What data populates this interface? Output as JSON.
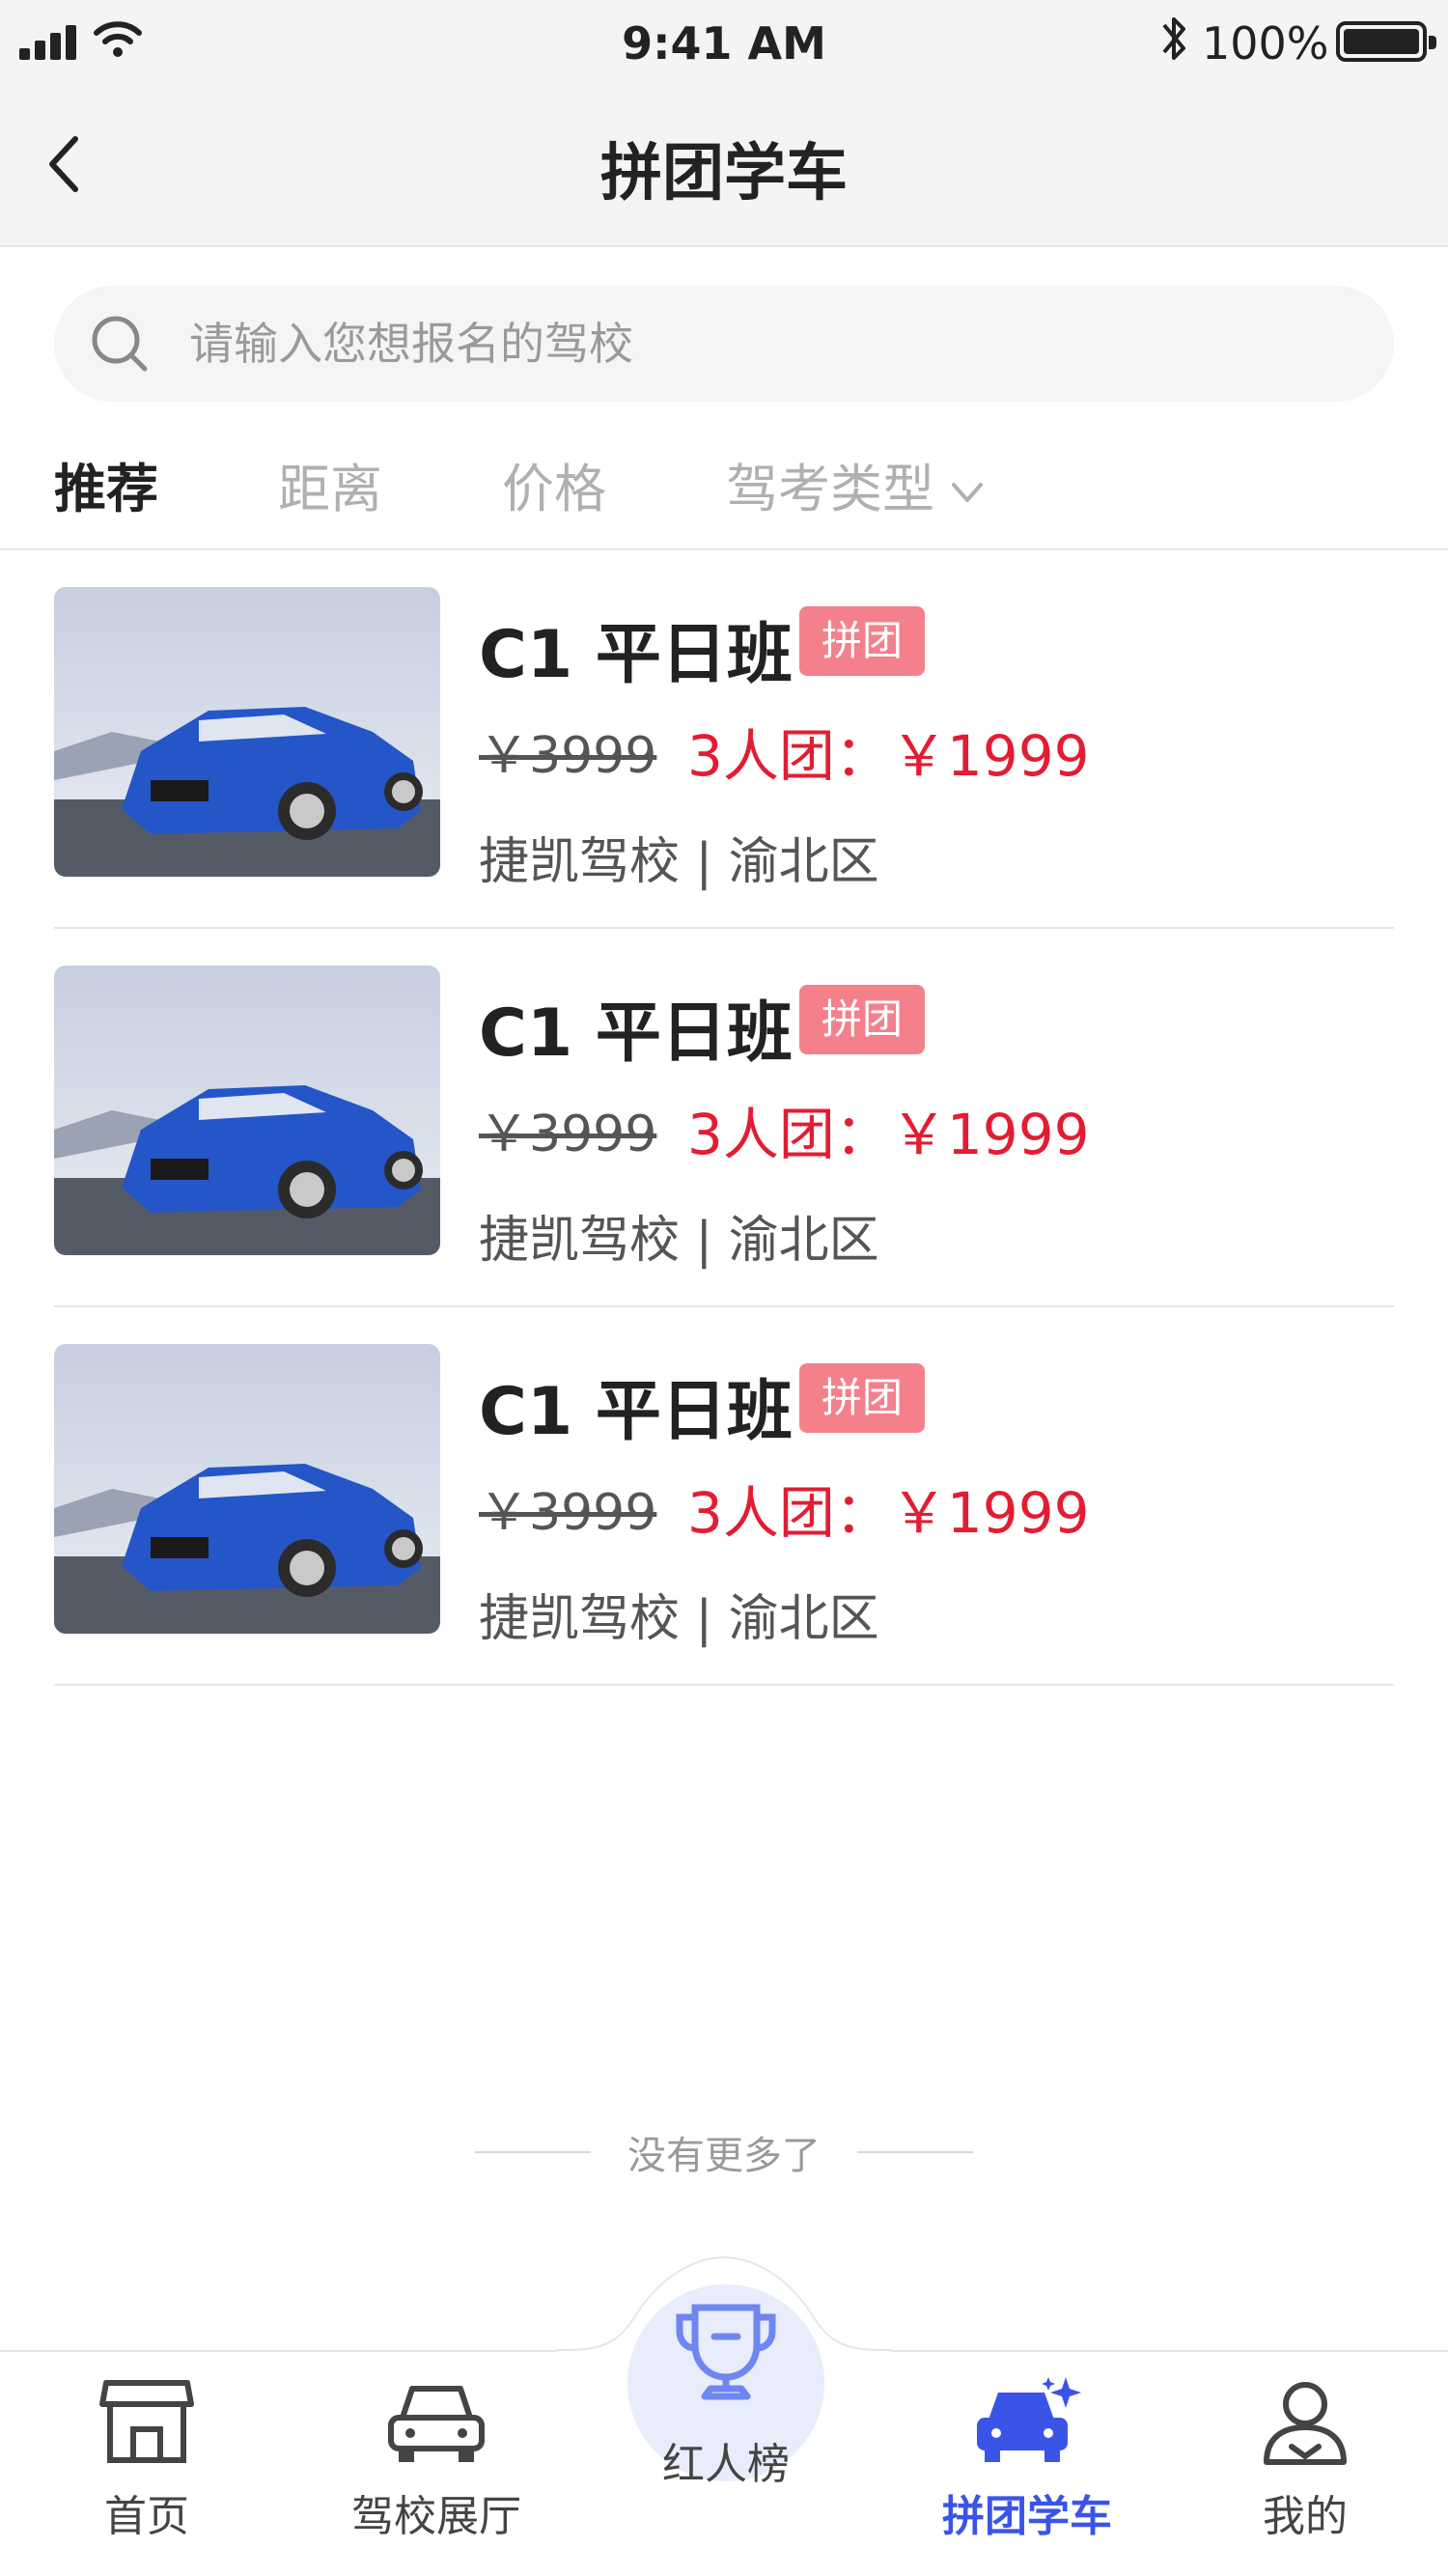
{
  "status_bar": {
    "time": "9:41 AM",
    "battery": "100%"
  },
  "header": {
    "title": "拼团学车"
  },
  "search": {
    "placeholder": "请输入您想报名的驾校"
  },
  "filters": [
    {
      "label": "推荐",
      "active": true
    },
    {
      "label": "距离",
      "active": false
    },
    {
      "label": "价格",
      "active": false
    },
    {
      "label": "驾考类型",
      "active": false,
      "dropdown": true
    }
  ],
  "listings": [
    {
      "name": "C1 平日班",
      "tag": "拼团",
      "original_price": "￥3999",
      "group_price": "3人团：￥1999",
      "school": "捷凯驾校 | 渝北区"
    },
    {
      "name": "C1 平日班",
      "tag": "拼团",
      "original_price": "￥3999",
      "group_price": "3人团：￥1999",
      "school": "捷凯驾校 | 渝北区"
    },
    {
      "name": "C1 平日班",
      "tag": "拼团",
      "original_price": "￥3999",
      "group_price": "3人团：￥1999",
      "school": "捷凯驾校 | 渝北区"
    }
  ],
  "footer_note": "没有更多了",
  "tabbar": [
    {
      "label": "首页",
      "icon": "store-icon",
      "active": false
    },
    {
      "label": "驾校展厅",
      "icon": "car-outline-icon",
      "active": false
    },
    {
      "label": "红人榜",
      "icon": "trophy-icon",
      "active": false
    },
    {
      "label": "拼团学车",
      "icon": "car-sparkle-icon",
      "active": true
    },
    {
      "label": "我的",
      "icon": "user-icon",
      "active": false
    }
  ],
  "colors": {
    "accent": "#3b54e8",
    "price_red": "#e21d32",
    "tag_pink": "#f4808c"
  }
}
